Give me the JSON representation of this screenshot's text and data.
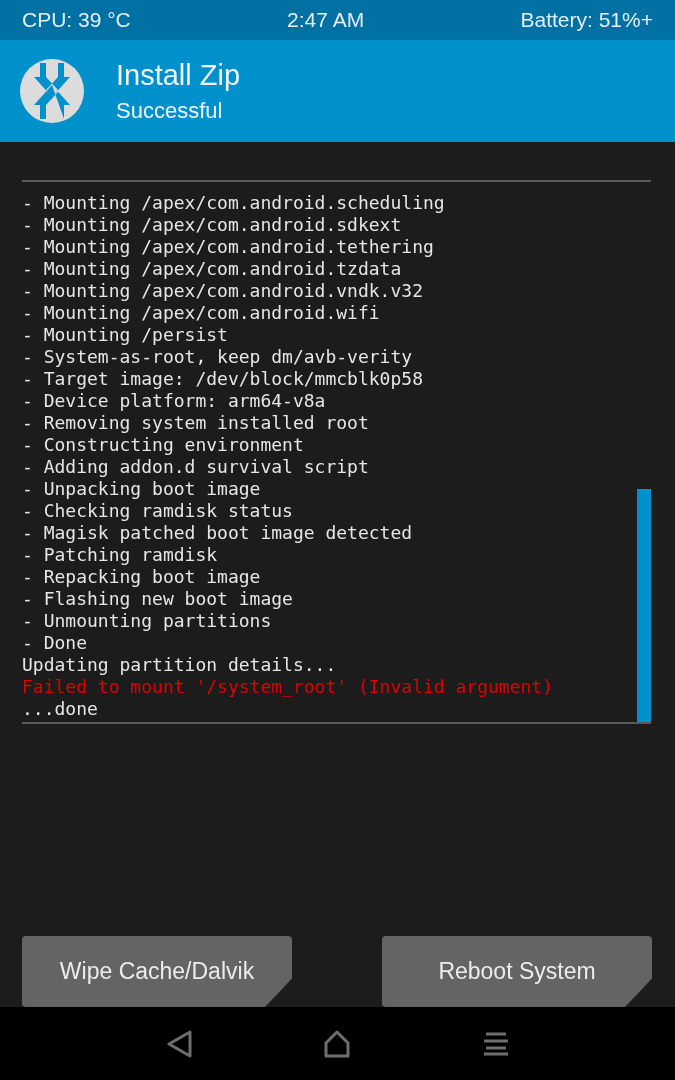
{
  "status_bar": {
    "cpu": "CPU: 39 °C",
    "time": "2:47 AM",
    "battery": "Battery: 51%+"
  },
  "header": {
    "title": "Install Zip",
    "subtitle": "Successful"
  },
  "log": [
    {
      "text": "- Mounting /apex/com.android.scheduling",
      "kind": "info"
    },
    {
      "text": "- Mounting /apex/com.android.sdkext",
      "kind": "info"
    },
    {
      "text": "- Mounting /apex/com.android.tethering",
      "kind": "info"
    },
    {
      "text": "- Mounting /apex/com.android.tzdata",
      "kind": "info"
    },
    {
      "text": "- Mounting /apex/com.android.vndk.v32",
      "kind": "info"
    },
    {
      "text": "- Mounting /apex/com.android.wifi",
      "kind": "info"
    },
    {
      "text": "- Mounting /persist",
      "kind": "info"
    },
    {
      "text": "- System-as-root, keep dm/avb-verity",
      "kind": "info"
    },
    {
      "text": "- Target image: /dev/block/mmcblk0p58",
      "kind": "info"
    },
    {
      "text": "- Device platform: arm64-v8a",
      "kind": "info"
    },
    {
      "text": "- Removing system installed root",
      "kind": "info"
    },
    {
      "text": "- Constructing environment",
      "kind": "info"
    },
    {
      "text": "- Adding addon.d survival script",
      "kind": "info"
    },
    {
      "text": "- Unpacking boot image",
      "kind": "info"
    },
    {
      "text": "- Checking ramdisk status",
      "kind": "info"
    },
    {
      "text": "- Magisk patched boot image detected",
      "kind": "info"
    },
    {
      "text": "- Patching ramdisk",
      "kind": "info"
    },
    {
      "text": "- Repacking boot image",
      "kind": "info"
    },
    {
      "text": "- Flashing new boot image",
      "kind": "info"
    },
    {
      "text": "- Unmounting partitions",
      "kind": "info"
    },
    {
      "text": "- Done",
      "kind": "info"
    },
    {
      "text": "Updating partition details...",
      "kind": "info"
    },
    {
      "text": "Failed to mount '/system_root' (Invalid argument)",
      "kind": "error"
    },
    {
      "text": "...done",
      "kind": "info"
    }
  ],
  "buttons": [
    {
      "label": "Wipe Cache/Dalvik"
    },
    {
      "label": "Reboot System"
    }
  ]
}
